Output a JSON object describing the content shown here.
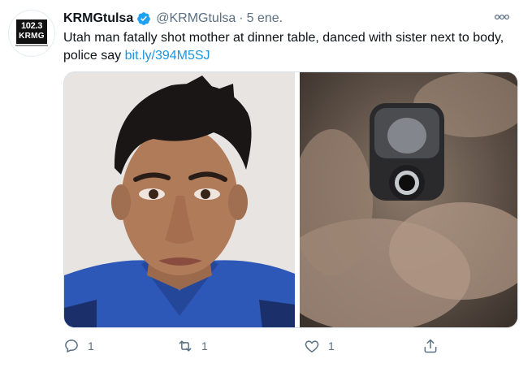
{
  "account": {
    "display_name": "KRMGtulsa",
    "handle": "@KRMGtulsa",
    "separator": "·",
    "timestamp": "5 ene.",
    "logo_number": "102.3",
    "logo_callsign": "KRMG"
  },
  "tweet": {
    "text": "Utah man fatally shot mother at dinner table, danced with sister next to body, police say",
    "link_text": "bit.ly/394M5SJ"
  },
  "actions": {
    "reply_count": "1",
    "retweet_count": "1",
    "like_count": "1"
  },
  "icons": {
    "verified": "verified-badge-icon",
    "more": "more-options-icon",
    "reply": "reply-icon",
    "retweet": "retweet-icon",
    "like": "heart-icon",
    "share": "share-icon"
  },
  "colors": {
    "link": "#1b95e0",
    "verified": "#1da1f2",
    "secondary_text": "#5b7083"
  }
}
